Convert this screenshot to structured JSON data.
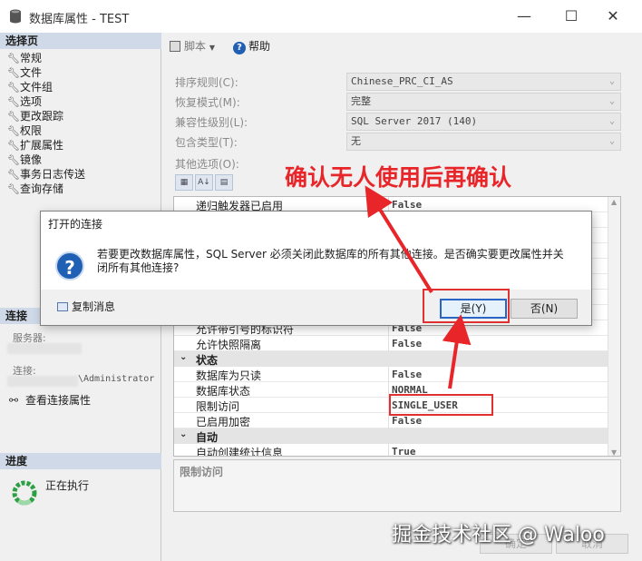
{
  "window": {
    "title": "数据库属性 - TEST",
    "minimize": "—",
    "maximize": "☐",
    "close": "✕"
  },
  "left": {
    "select_page_header": "选择页",
    "pages": [
      "常规",
      "文件",
      "文件组",
      "选项",
      "更改跟踪",
      "权限",
      "扩展属性",
      "镜像",
      "事务日志传送",
      "查询存储"
    ],
    "connection_header": "连接",
    "server_label": "服务器:",
    "connection_label": "连接:",
    "connection_value": "\\Administrator",
    "view_connection_props": "查看连接属性",
    "progress_header": "进度",
    "progress_status": "正在执行"
  },
  "toolbar": {
    "script_label": "脚本",
    "help_label": "帮助"
  },
  "props": [
    {
      "label": "排序规则(C):",
      "value": "Chinese_PRC_CI_AS"
    },
    {
      "label": "恢复模式(M):",
      "value": "完整"
    },
    {
      "label": "兼容性级别(L):",
      "value": "SQL Server 2017 (140)"
    },
    {
      "label": "包含类型(T):",
      "value": "无"
    }
  ],
  "other_options_label": "其他选项(O):",
  "grid": {
    "top_rows": [
      {
        "name": "递归触发器已启用",
        "value": "False"
      }
    ],
    "mid_rows": [
      {
        "name": "允许带引号的标识符",
        "value": "False"
      },
      {
        "name": "允许快照隔离",
        "value": "False"
      }
    ],
    "cat_state": "状态",
    "state_rows": [
      {
        "name": "数据库为只读",
        "value": "False"
      },
      {
        "name": "数据库状态",
        "value": "NORMAL"
      },
      {
        "name": "限制访问",
        "value": "SINGLE_USER"
      },
      {
        "name": "已启用加密",
        "value": "False"
      }
    ],
    "cat_auto": "自动",
    "auto_rows": [
      {
        "name": "自动创建统计信息",
        "value": "True"
      }
    ]
  },
  "description_title": "限制访问",
  "bottom": {
    "ok": "确定",
    "cancel": "取消"
  },
  "dialog": {
    "title": "打开的连接",
    "icon": "?",
    "message": "若要更改数据库属性，SQL Server 必须关闭此数据库的所有其他连接。是否确实要更改属性并关闭所有其他连接?",
    "copy_message": "复制消息",
    "yes": "是(Y)",
    "no": "否(N)"
  },
  "annotation": {
    "text": "确认无人使用后再确认",
    "color": "#e8262a"
  },
  "watermark": "掘金技术社区 @ Waloo"
}
